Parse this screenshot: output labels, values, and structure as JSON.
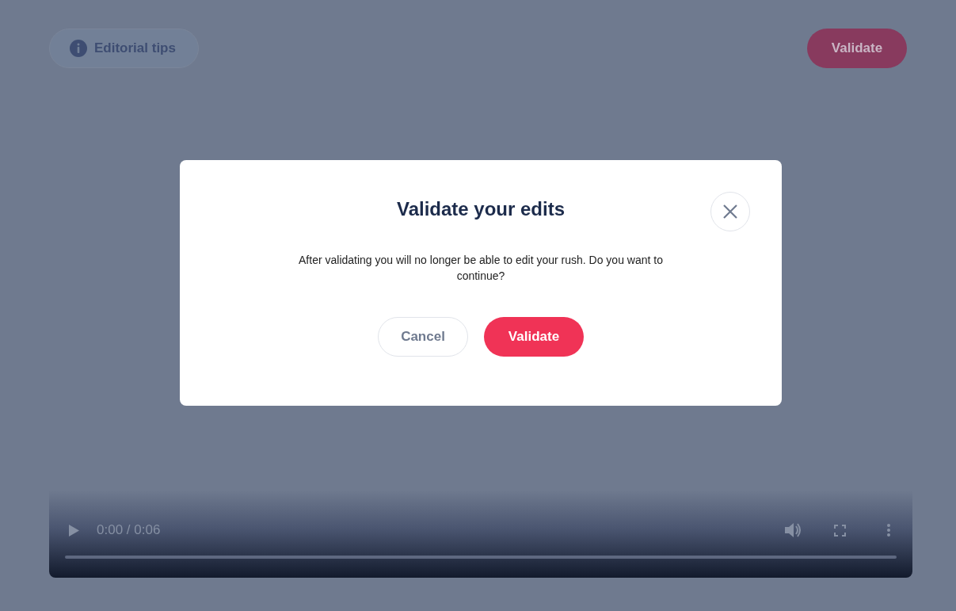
{
  "toolbar": {
    "tips_button": {
      "label": "Editorial tips"
    },
    "validate_button": {
      "label": "Validate"
    }
  },
  "video": {
    "time": "0:00 / 0:06"
  },
  "dialog": {
    "title": "Validate your edits",
    "message": "After validating you will no longer be able to edit your rush. Do you want to continue?",
    "buttons": [
      {
        "label": "Cancel",
        "kind": "secondary"
      },
      {
        "label": "Validate",
        "kind": "primary"
      }
    ]
  }
}
